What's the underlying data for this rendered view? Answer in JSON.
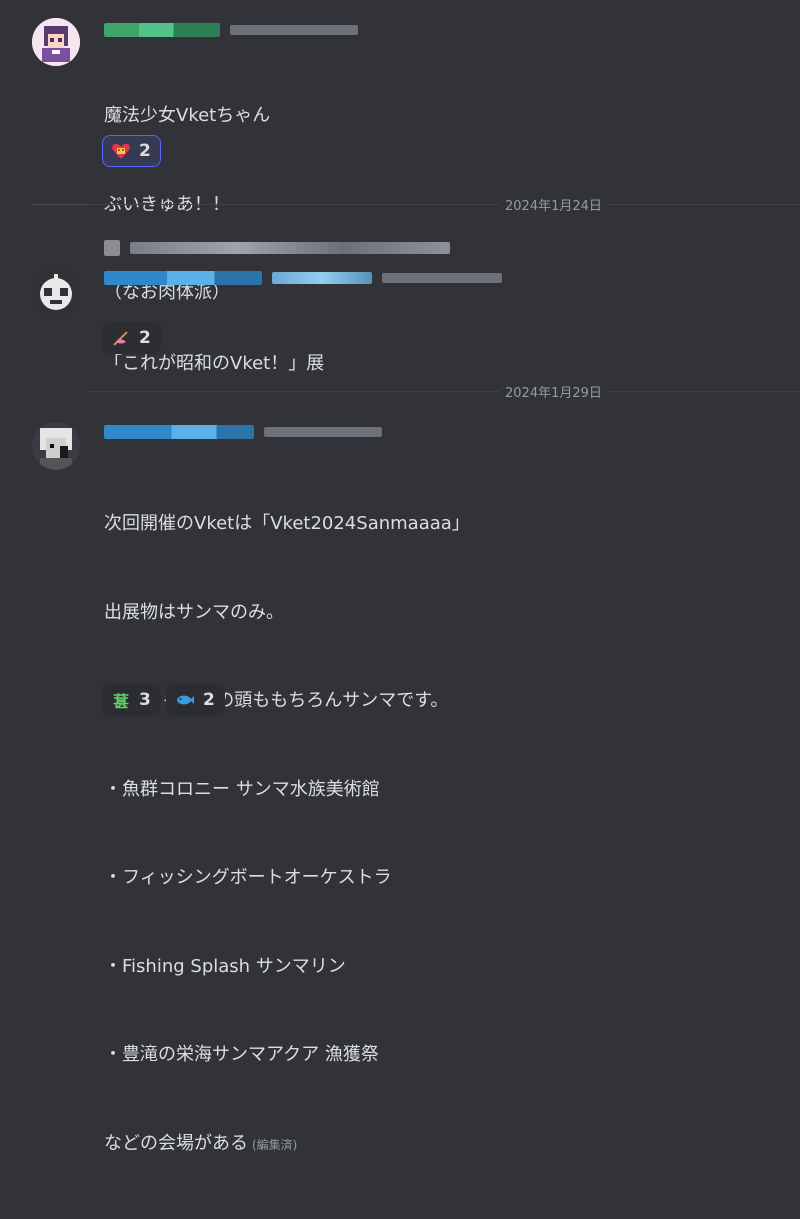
{
  "messages": [
    {
      "lines": [
        "魔法少女Vketちゃん",
        "ぶいきゅあ！！",
        "（なお肉体派）"
      ],
      "reactions": [
        {
          "emoji": "fist-heart-emoji",
          "count": "2",
          "me": true
        }
      ]
    },
    {
      "lines": [
        "「これが昭和のVket！」展"
      ],
      "reactions": [
        {
          "emoji": "fishing-rod-emoji",
          "count": "2",
          "me": false
        }
      ]
    },
    {
      "lines": [
        "次回開催のVketは「Vket2024Sanmaaaa」",
        "出展物はサンマのみ。",
        "Vketちゃん達の頭ももちろんサンマです。",
        "・魚群コロニー サンマ水族美術館",
        "・フィッシングボートオーケストラ",
        "・Fishing Splash サンマリン",
        "・豊滝の栄海サンマアクア 漁獲祭",
        "などの会場がある"
      ],
      "edited_label": "(編集済)",
      "reactions": [
        {
          "emoji": "kanji-emoji",
          "glyph": "葚",
          "count": "3",
          "me": false
        },
        {
          "emoji": "fish-emoji",
          "glyph": "🐟",
          "count": "2",
          "me": false
        }
      ]
    }
  ],
  "dividers": [
    {
      "date": "2024年1月24日"
    },
    {
      "date": "2024年1月29日"
    }
  ],
  "colors": {
    "background": "#313338",
    "text": "#dbdee1",
    "muted": "#949ba4",
    "reaction_bg": "#2b2d31",
    "reaction_me_bg": "#373a53",
    "reaction_me_border": "#5865f2"
  }
}
